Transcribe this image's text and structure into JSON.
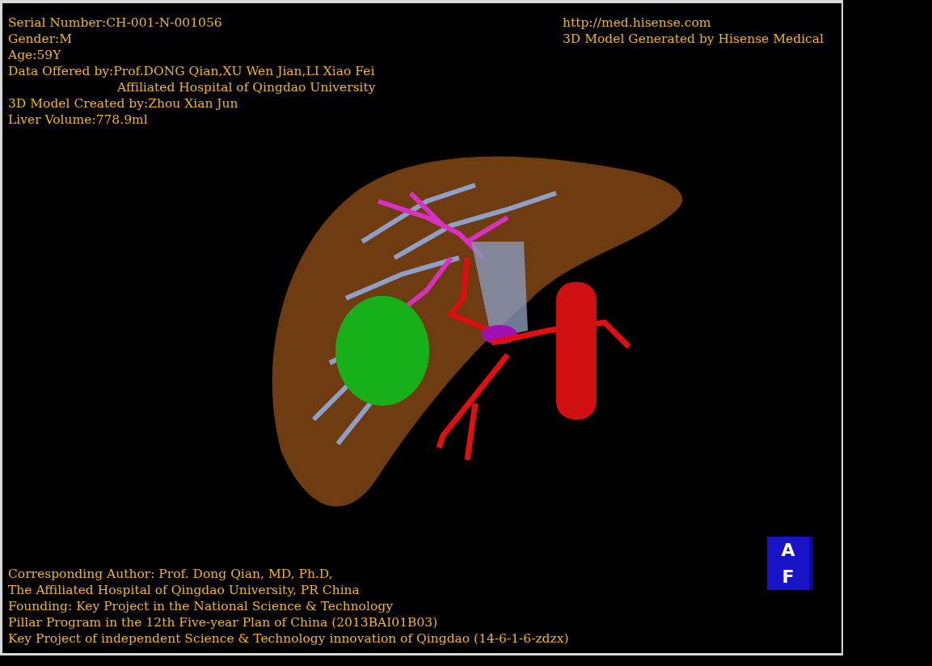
{
  "viewer": {
    "case_info": [
      {
        "text": "Serial Number:CH-001-N-001056",
        "kind": "line"
      },
      {
        "text": "Gender:M",
        "kind": "line"
      },
      {
        "text": "Age:59Y",
        "kind": "line"
      },
      {
        "text": "Data Offered by:Prof.DONG Qian,XU Wen Jian,LI Xiao Fei",
        "kind": "line"
      },
      {
        "text": "Affiliated Hospital of Qingdao University",
        "kind": "continuation"
      },
      {
        "text": "3D Model Created by:Zhou Xian Jun",
        "kind": "line"
      },
      {
        "text": "Liver Volume:778.9ml",
        "kind": "line"
      }
    ],
    "credits": [
      "http://med.hisense.com",
      "3D Model Generated by Hisense Medical"
    ],
    "orientation_cube": {
      "top": "A",
      "front": "F"
    },
    "footer": [
      "Corresponding Author: Prof. Dong Qian, MD, Ph.D,",
      "The Affiliated Hospital of Qingdao University, PR China",
      "Founding: Key Project in the National Science & Technology",
      "Pillar Program in the 12th Five-year Plan of China (2013BAI01B03)",
      "Key Project of independent Science & Technology innovation of Qingdao (14-6-1-6-zdzx)"
    ]
  }
}
